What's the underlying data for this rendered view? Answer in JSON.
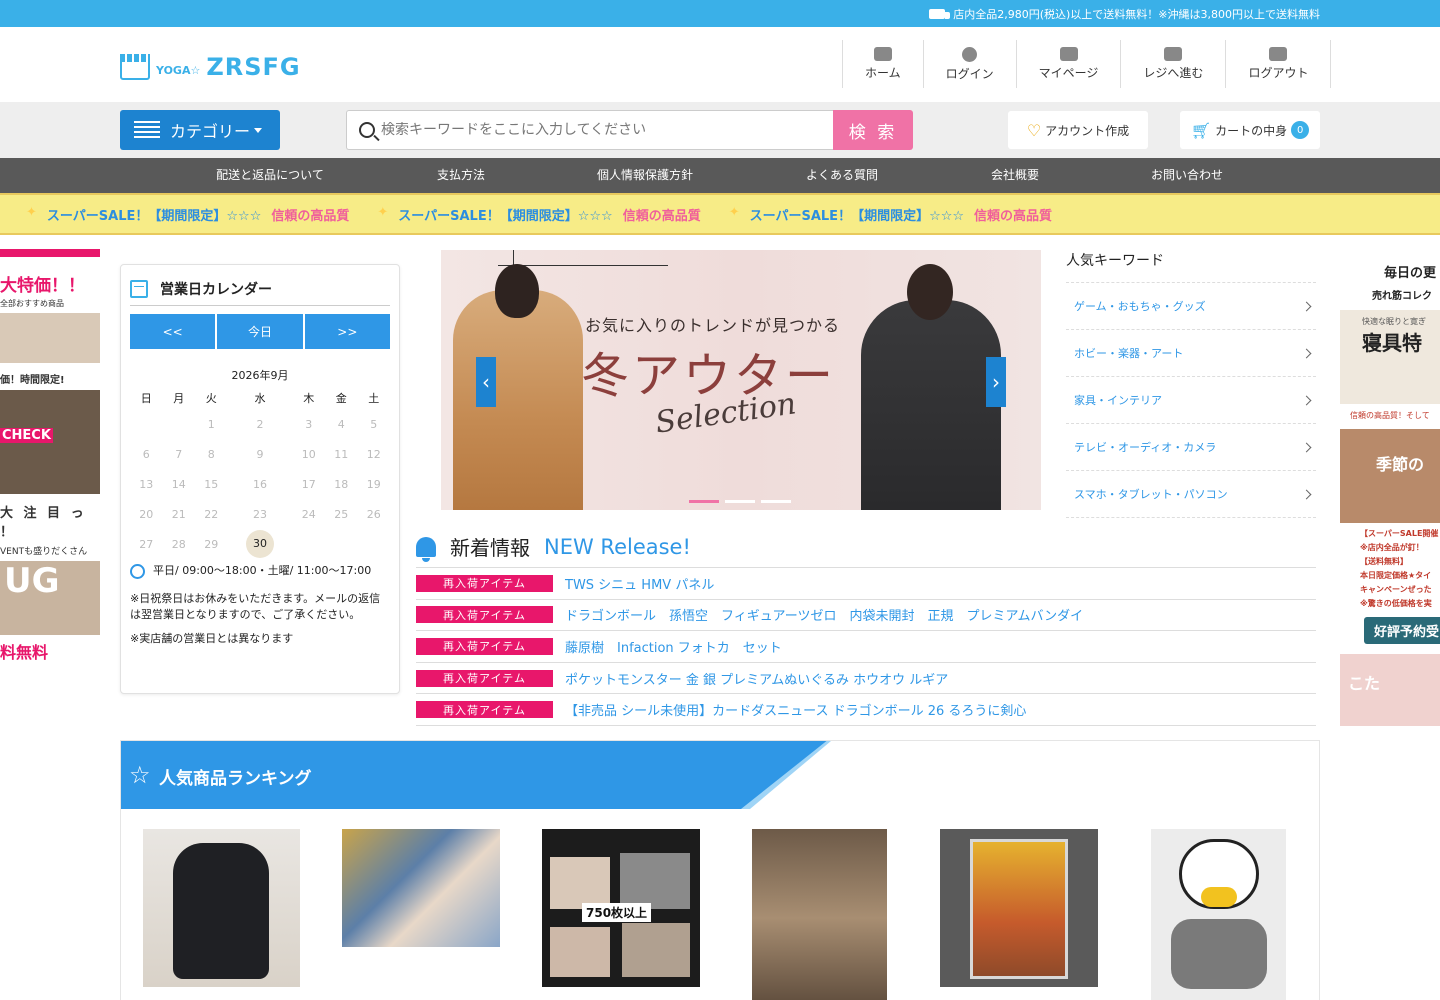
{
  "notice": {
    "text": "店内全品2,980円(税込)以上で送料無料！※沖縄は3,800円以上で送料無料"
  },
  "logo": {
    "prefix": "YOGA☆",
    "name": "ZRSFG"
  },
  "top_nav": [
    {
      "label": "ホーム",
      "icon": "home-icon"
    },
    {
      "label": "ログイン",
      "icon": "user-icon"
    },
    {
      "label": "マイページ",
      "icon": "id-card-icon"
    },
    {
      "label": "レジへ進む",
      "icon": "cash-icon"
    },
    {
      "label": "ログアウト",
      "icon": "logout-icon"
    }
  ],
  "category_button": {
    "label": "カテゴリー"
  },
  "search": {
    "placeholder": "検索キーワードをここに入力してください",
    "button_label": "検 索"
  },
  "account_button": {
    "label": "アカウント作成"
  },
  "cart_button": {
    "label": "カートの中身",
    "count": "0"
  },
  "main_nav": [
    "配送と返品について",
    "支払方法",
    "個人情報保護方針",
    "よくある質問",
    "会社概要",
    "お問い合わせ"
  ],
  "ribbon": {
    "part1": "スーパーSALE！【期間限定】☆☆☆",
    "part2": "信頼の高品質"
  },
  "left_ads": {
    "title1": "大特価！！",
    "title1_sub": "全部おすすめ商品",
    "title2": "価！時間限定!",
    "check": "CHECK",
    "title3": "大 注 目 っ ！",
    "title3_sub": "VENTも盛りだくさん",
    "ug": "UG",
    "free": "料無料"
  },
  "calendar": {
    "title": "営業日カレンダー",
    "prev_label": "<<",
    "today_label": "今日",
    "next_label": ">>",
    "month": "2026年9月",
    "weekdays": [
      "日",
      "月",
      "火",
      "水",
      "木",
      "金",
      "土"
    ],
    "weeks": [
      [
        "",
        "",
        "1",
        "2",
        "3",
        "4",
        "5"
      ],
      [
        "6",
        "7",
        "8",
        "9",
        "10",
        "11",
        "12"
      ],
      [
        "13",
        "14",
        "15",
        "16",
        "17",
        "18",
        "19"
      ],
      [
        "20",
        "21",
        "22",
        "23",
        "24",
        "25",
        "26"
      ],
      [
        "27",
        "28",
        "29",
        "30",
        "",
        "",
        ""
      ]
    ],
    "today": "30",
    "hours": "平日/ 09:00～18:00・土曜/ 11:00～17:00",
    "note1": "※日祝祭日はお休みをいただきます。メールの返信は翌営業日となりますので、ご了承ください。",
    "note2": "※実店舗の営業日とは異なります"
  },
  "hero": {
    "subtitle": "お気に入りのトレンドが見つかる",
    "title": "冬アウター",
    "script": "Selection",
    "slides": 3,
    "active_slide": 1
  },
  "keywords": {
    "title": "人気キーワード",
    "items": [
      "ゲーム・おもちゃ・グッズ",
      "ホビー・楽器・アート",
      "家具・インテリア",
      "テレビ・オーディオ・カメラ",
      "スマホ・タブレット・パソコン"
    ]
  },
  "right_ads": {
    "title": "毎日の更",
    "title_sub": "売れ筋コレク",
    "box1_small": "快適な眠りと寛ぎ",
    "box1_big": "寝具特",
    "caption1": "信頼の高品質！そして",
    "box2": "季節の",
    "red_lines": [
      "【スーパーSALE開催",
      "※店内全品が釘！",
      "【送料無料】",
      "本日限定価格★タイ",
      "キャンペーンぜった",
      "※驚きの低価格を実"
    ],
    "pill": "好評予約受",
    "box3": "こた"
  },
  "news": {
    "title": "新着情報",
    "title_en": "NEW Release!",
    "tag": "再入荷アイテム",
    "items": [
      "TWS シニュ HMV パネル",
      "ドラゴンボール　孫悟空　フィギュアーツゼロ　内袋未開封　正規　プレミアムバンダイ",
      "藤原樹　Infaction フォトカ　セット",
      "ポケットモンスター 金 銀 プレミアムぬいぐるみ ホウオウ ルギア",
      "【非売品 シール未使用】カードダスニュース ドラゴンボール 26 るろうに剣心"
    ]
  },
  "ranking": {
    "title": "人気商品ランキング",
    "badge_text": "750枚以上"
  },
  "colors": {
    "primary": "#2f97e6",
    "pink": "#f072a6",
    "tag": "#e8176b",
    "nav": "#595959"
  }
}
